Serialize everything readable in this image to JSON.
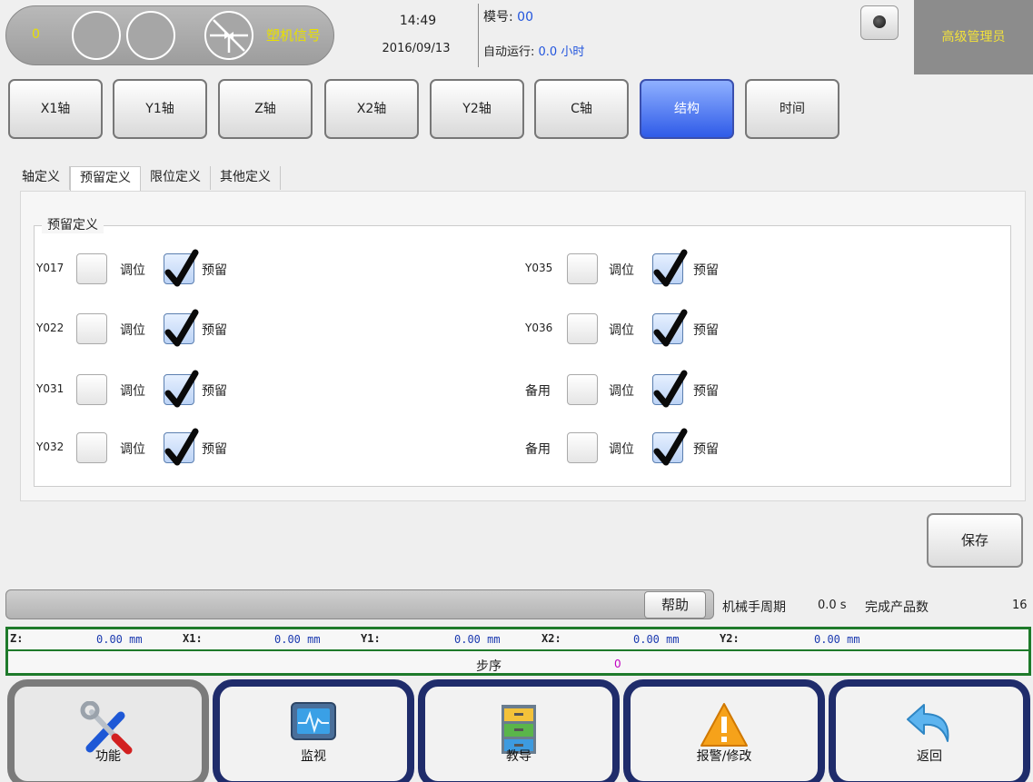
{
  "header": {
    "counter": "0",
    "signal_label": "塑机信号",
    "time": "14:49",
    "date": "2016/09/13",
    "mold_label": "模号:",
    "mold_value": "00",
    "auto_run_label": "自动运行:",
    "auto_run_value": "0.0 小时",
    "user": "高级管理员"
  },
  "tabs": [
    {
      "label": "X1轴"
    },
    {
      "label": "Y1轴"
    },
    {
      "label": "Z轴"
    },
    {
      "label": "X2轴"
    },
    {
      "label": "Y2轴"
    },
    {
      "label": "C轴"
    },
    {
      "label": "结构",
      "active": true
    },
    {
      "label": "时间"
    }
  ],
  "subtabs": [
    {
      "label": "轴定义"
    },
    {
      "label": "预留定义",
      "selected": true
    },
    {
      "label": "限位定义"
    },
    {
      "label": "其他定义"
    }
  ],
  "group_title": "预留定义",
  "option_labels": {
    "adjust": "调位",
    "reserve": "预留"
  },
  "rows": [
    {
      "left": {
        "name": "Y017",
        "adjust": false,
        "reserve": true
      },
      "right": {
        "name": "Y035",
        "adjust": false,
        "reserve": true
      }
    },
    {
      "left": {
        "name": "Y022",
        "adjust": false,
        "reserve": true
      },
      "right": {
        "name": "Y036",
        "adjust": false,
        "reserve": true
      }
    },
    {
      "left": {
        "name": "Y031",
        "adjust": false,
        "reserve": true
      },
      "right": {
        "name": "备用",
        "adjust": false,
        "reserve": true
      }
    },
    {
      "left": {
        "name": "Y032",
        "adjust": false,
        "reserve": true
      },
      "right": {
        "name": "备用",
        "adjust": false,
        "reserve": true
      }
    }
  ],
  "save_label": "保存",
  "status": {
    "help": "帮助",
    "cycle_label": "机械手周期",
    "cycle_value": "0.0 s",
    "done_label": "完成产品数",
    "done_value": "16"
  },
  "positions": [
    {
      "axis": "Z:",
      "value": "0.00",
      "unit": "mm"
    },
    {
      "axis": "X1:",
      "value": "0.00",
      "unit": "mm"
    },
    {
      "axis": "Y1:",
      "value": "0.00",
      "unit": "mm"
    },
    {
      "axis": "X2:",
      "value": "0.00",
      "unit": "mm"
    },
    {
      "axis": "Y2:",
      "value": "0.00",
      "unit": "mm"
    }
  ],
  "step_label": "步序",
  "step_value": "0",
  "nav": [
    {
      "label": "功能",
      "icon": "tools-icon"
    },
    {
      "label": "监视",
      "icon": "monitor-icon"
    },
    {
      "label": "教导",
      "icon": "cabinet-icon"
    },
    {
      "label": "报警/修改",
      "icon": "warning-icon"
    },
    {
      "label": "返回",
      "icon": "return-arrow-icon"
    }
  ],
  "colors": {
    "active_tab": "#2f5be8",
    "nav_border": "#1f2c6b",
    "status_border": "#1e7a2a",
    "signal_text": "#e8e000"
  }
}
